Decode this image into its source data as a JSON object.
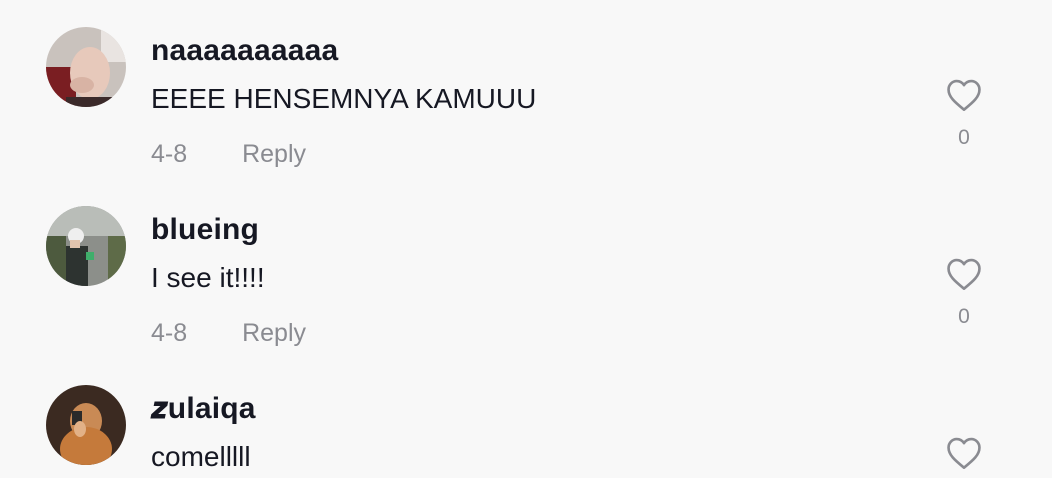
{
  "comments": [
    {
      "username": "naaaaaaaaaa",
      "text": "EEEE HENSEMNYA KAMUUU",
      "date": "4-8",
      "reply_label": "Reply",
      "likes": "0",
      "avatar_icon": "user-avatar"
    },
    {
      "username": "blueing",
      "text": "I see it!!!!",
      "date": "4-8",
      "reply_label": "Reply",
      "likes": "0",
      "avatar_icon": "user-avatar"
    },
    {
      "username": "𝒛ulaiqa",
      "text": "comelllll",
      "date": "",
      "reply_label": "",
      "likes": "",
      "avatar_icon": "user-avatar"
    }
  ],
  "colors": {
    "background": "#f8f8f8",
    "primary_text": "#161823",
    "secondary_text": "#8a8b91"
  },
  "icons": {
    "like": "heart-outline-icon"
  }
}
